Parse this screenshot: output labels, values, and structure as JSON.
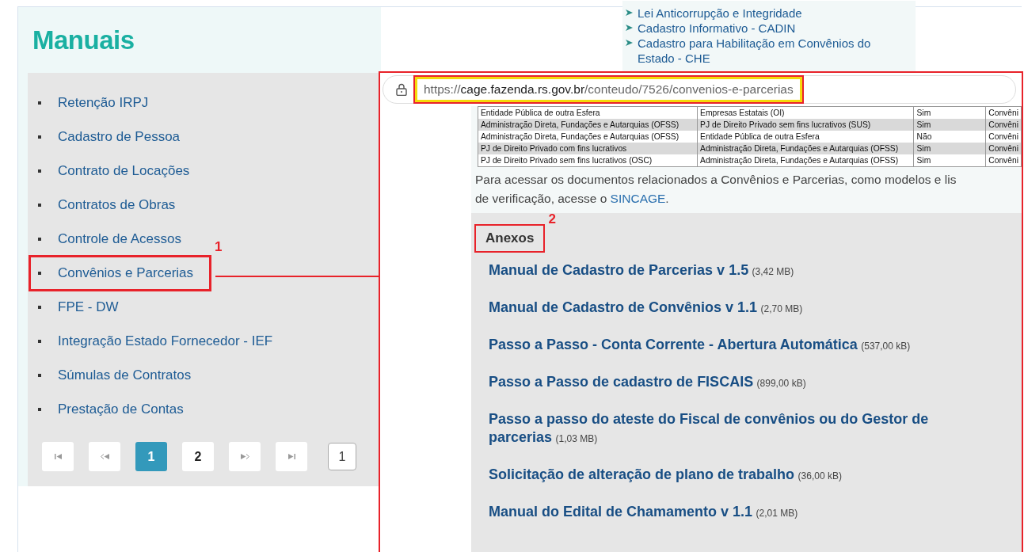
{
  "page_title": "Manuais",
  "related_links": [
    "Lei Anticorrupção e Integridade",
    "Cadastro Informativo - CADIN",
    "Cadastro para Habilitação em Convênios do Estado - CHE"
  ],
  "manuals": [
    {
      "label": "Retenção IRPJ",
      "highlighted": false
    },
    {
      "label": "Cadastro de Pessoa",
      "highlighted": false
    },
    {
      "label": "Contrato de Locações",
      "highlighted": false
    },
    {
      "label": "Contratos de Obras",
      "highlighted": false
    },
    {
      "label": "Controle de Acessos",
      "highlighted": false
    },
    {
      "label": "Convênios e Parcerias",
      "highlighted": true
    },
    {
      "label": "FPE - DW",
      "highlighted": false
    },
    {
      "label": "Integração Estado Fornecedor - IEF",
      "highlighted": false
    },
    {
      "label": "Súmulas de Contratos",
      "highlighted": false
    },
    {
      "label": "Prestação de Contas",
      "highlighted": false
    }
  ],
  "pagination": {
    "buttons": [
      {
        "kind": "first",
        "selected": false
      },
      {
        "kind": "prev",
        "selected": false
      },
      {
        "kind": "page",
        "label": "1",
        "selected": true
      },
      {
        "kind": "page",
        "label": "2",
        "selected": false
      },
      {
        "kind": "next",
        "selected": false
      },
      {
        "kind": "last",
        "selected": false
      }
    ],
    "page_input": {
      "value": "1"
    }
  },
  "callout_labels": [
    "1",
    "2"
  ],
  "browser": {
    "url_scheme": "https://",
    "url_host": "cage.fazenda.rs.gov.br",
    "url_path": "/conteudo/7526/convenios-e-parcerias"
  },
  "table_rows": [
    [
      "Entidade Pública de outra Esfera",
      "Empresas Estatais (OI)",
      "Sim",
      "Convêni"
    ],
    [
      "Administração Direta, Fundações e Autarquias (OFSS)",
      "PJ de Direito Privado sem fins lucrativos (SUS)",
      "Sim",
      "Convêni"
    ],
    [
      "Administração Direta, Fundações e Autarquias (OFSS)",
      "Entidade Pública de outra Esfera",
      "Não",
      "Convêni"
    ],
    [
      "PJ de Direito Privado com fins lucrativos",
      "Administração Direta, Fundações e Autarquias (OFSS)",
      "Sim",
      "Convêni"
    ],
    [
      "PJ de Direito Privado sem fins lucrativos (OSC)",
      "Administração Direta, Fundações e Autarquias (OFSS)",
      "Sim",
      "Convêni"
    ]
  ],
  "paragraph": {
    "line_1": "Para acessar os documentos relacionados a Convênios e Parcerias, como modelos e lis",
    "line_2_before": "de verificação, acesse o ",
    "link": "SINCAGE",
    "line_2_after": "."
  },
  "anexos": {
    "heading": "Anexos",
    "files": [
      {
        "title": "Manual de Cadastro de Parcerias v 1.5",
        "size": "(3,42 MB)"
      },
      {
        "title": "Manual de Cadastro de Convênios v 1.1",
        "size": "(2,70 MB)"
      },
      {
        "title": "Passo a Passo - Conta Corrente - Abertura Automática",
        "size": "(537,00 kB)"
      },
      {
        "title": "Passo a Passo de cadastro de FISCAIS",
        "size": "(899,00 kB)"
      },
      {
        "title": "Passo a passo do ateste do Fiscal de convênios ou do Gestor de parcerias",
        "size": "(1,03 MB)"
      },
      {
        "title": "Solicitação de alteração de plano de trabalho",
        "size": "(36,00 kB)"
      },
      {
        "title": "Manual do Edital de Chamamento v 1.1",
        "size": "(2,01 MB)"
      }
    ]
  }
}
